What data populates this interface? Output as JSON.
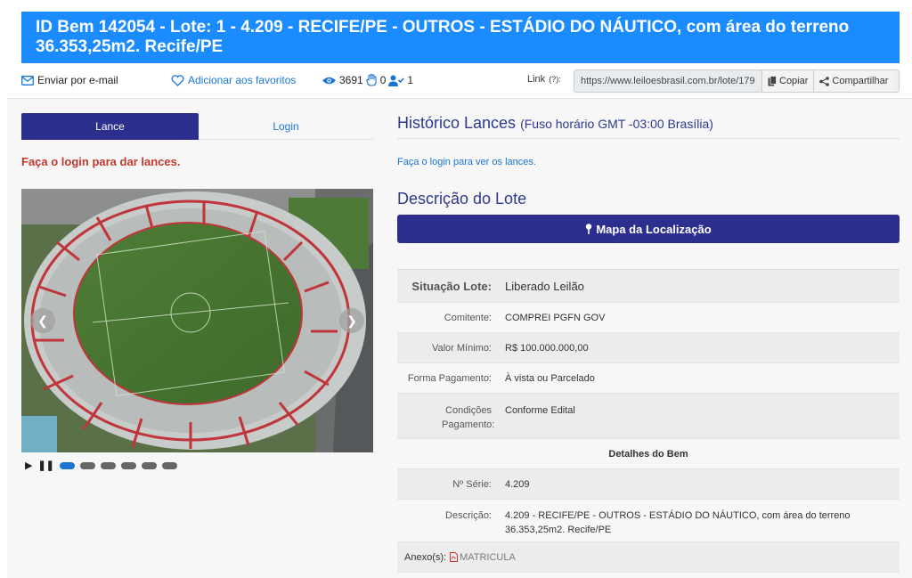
{
  "header": {
    "title": "ID Bem 142054 - Lote: 1 - 4.209 - RECIFE/PE - OUTROS - ESTÁDIO DO NÁUTICO, com área do terreno 36.353,25m2. Recife/PE"
  },
  "actions": {
    "email": "Enviar por e-mail",
    "favorites": "Adicionar aos favoritos",
    "views": "3691",
    "bids": "0",
    "users": "1",
    "link_label": "Link",
    "link_help": "(?):",
    "link_value": "https://www.leiloesbrasil.com.br/lote/179",
    "copy": "Copiar",
    "share": "Compartilhar"
  },
  "tabs": {
    "lance": "Lance",
    "login": "Login"
  },
  "login_message": "Faça o login para dar lances.",
  "carousel": {
    "slide_count": 6,
    "active_slide": 1
  },
  "history": {
    "title": "Histórico Lances",
    "timezone": "(Fuso horário GMT -03:00 Brasília)",
    "message": "Faça o login para ver os lances."
  },
  "description": {
    "title": "Descrição do Lote",
    "map_button": "Mapa da Localização"
  },
  "details": {
    "situacao_label": "Situação Lote:",
    "situacao_value": "Liberado Leilão",
    "comitente_label": "Comitente:",
    "comitente_value": "COMPREI PGFN GOV",
    "valor_label": "Valor Mínimo:",
    "valor_value": "R$ 100.000.000,00",
    "forma_label": "Forma Pagamento:",
    "forma_value": "À vista ou Parcelado",
    "condicoes_label": "Condições Pagamento:",
    "condicoes_value": "Conforme Edital",
    "bem_header": "Detalhes do Bem",
    "serie_label": "Nº Série:",
    "serie_value": "4.209",
    "descricao_label": "Descrição:",
    "descricao_value": "4.209 - RECIFE/PE - OUTROS - ESTÁDIO DO NÁUTICO, com área do terreno 36.353,25m2. Recife/PE",
    "anexos_label": "Anexo(s):",
    "anexo_file": "MATRICULA"
  },
  "colors": {
    "header_bg": "#1a8cff",
    "primary_dark": "#2d2f8f",
    "link_blue": "#1a75d2",
    "alert_red": "#c0392b"
  }
}
